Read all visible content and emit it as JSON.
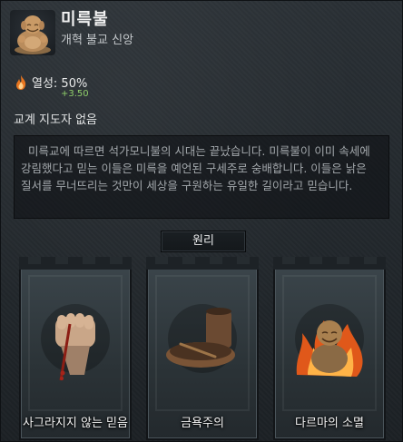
{
  "religion": {
    "name": "미륵불",
    "subtitle": "개혁 불교 신앙",
    "portrait_icon": "buddha-statue-icon"
  },
  "fervor": {
    "label": "열성: 50%",
    "delta": "+3.50",
    "icon": "flame-icon"
  },
  "head_of_faith": "교계 지도자 없음",
  "description": "미륵교에 따르면 석가모니불의 시대는 끝났습니다. 미륵불이 이미 속세에 강림했다고 믿는 이들은 미륵을 예언된 구세주로 숭배합니다. 이들은 낡은 질서를 무너뜨리는 것만이 세상을 구원하는 유일한 길이라고 믿습니다.",
  "tenets": {
    "header": "원리",
    "items": [
      {
        "label": "사그라지지 않는 믿음",
        "icon": "clenched-fist-icon"
      },
      {
        "label": "금욕주의",
        "icon": "bowl-and-cup-icon"
      },
      {
        "label": "다르마의 소멸",
        "icon": "burning-buddha-icon"
      }
    ]
  },
  "colors": {
    "panel_bg": "#252b30",
    "positive_delta": "#8fce6a",
    "flame": "#e86a1c"
  }
}
